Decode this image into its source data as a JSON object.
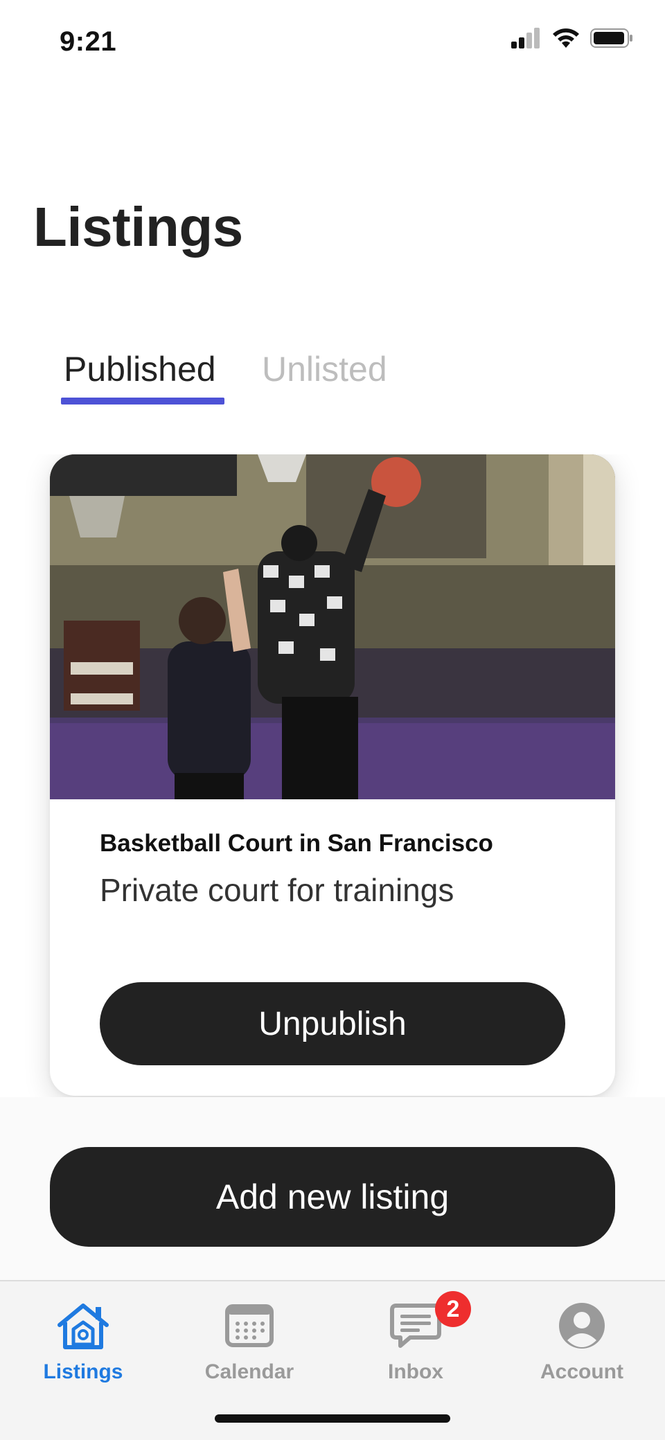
{
  "status_bar": {
    "time": "9:21",
    "icons": [
      "signal-icon",
      "wifi-icon",
      "battery-icon"
    ]
  },
  "page": {
    "title": "Listings"
  },
  "tabs": [
    {
      "label": "Published",
      "active": true
    },
    {
      "label": "Unlisted",
      "active": false
    }
  ],
  "listing": {
    "image": "basketball-court-photo",
    "title": "Basketball Court in San Francisco",
    "subtitle": "Private court for trainings",
    "action_label": "Unpublish"
  },
  "add_button": {
    "label": "Add new listing"
  },
  "nav": {
    "items": [
      {
        "label": "Listings",
        "icon": "home-icon",
        "active": true
      },
      {
        "label": "Calendar",
        "icon": "calendar-icon",
        "active": false
      },
      {
        "label": "Inbox",
        "icon": "chat-icon",
        "active": false,
        "badge": "2"
      },
      {
        "label": "Account",
        "icon": "account-icon",
        "active": false
      }
    ]
  },
  "colors": {
    "accent": "#4d52d6",
    "nav_active": "#1f7ae0",
    "button": "#222222",
    "badge": "#ee2e2e"
  }
}
